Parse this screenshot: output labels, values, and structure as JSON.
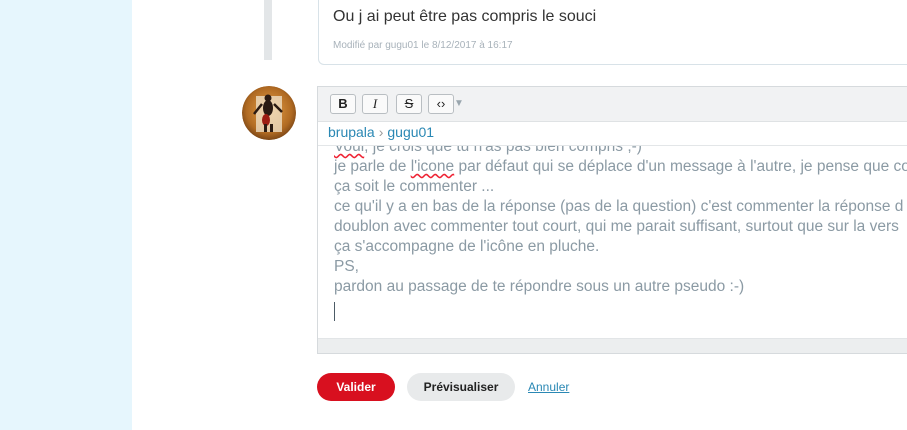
{
  "previous_message": {
    "text": "Ou j ai peut être pas compris le souci",
    "meta": "Modifié par gugu01 le 8/12/2017 à 16:17"
  },
  "editor": {
    "toolbar": {
      "bold_label": "B",
      "italic_label": "I",
      "strike_label": "S",
      "code_label": "‹›",
      "dropdown_label": "▼"
    },
    "breadcrumb": {
      "first": "brupala",
      "separator": "›",
      "second": "gugu01"
    },
    "content": {
      "line0_pre": "",
      "line0_word": "Voui",
      "line0_post": ", je crois que tu n'as pas bien compris ;-)",
      "line1_pre": "je parle de ",
      "line1_word": "l'icone",
      "line1_post": " par défaut qui se déplace d'un message à l'autre, je pense que co",
      "line2": "ça soit le commenter ...",
      "line3": "ce qu'il y a en bas de la réponse (pas de la question) c'est commenter la réponse d",
      "line4": "doublon avec commenter tout court, qui me parait suffisant, surtout que sur la vers",
      "line5": "ça s'accompagne de l'icône en pluche.",
      "line6": "PS,",
      "line7": "pardon au passage de te répondre sous un autre pseudo :-)"
    }
  },
  "actions": {
    "submit_label": "Valider",
    "preview_label": "Prévisualiser",
    "cancel_label": "Annuler"
  },
  "colors": {
    "accent_red": "#d8101f",
    "link_blue": "#2a88b4",
    "sidebar_bg": "#e6f6fd"
  }
}
